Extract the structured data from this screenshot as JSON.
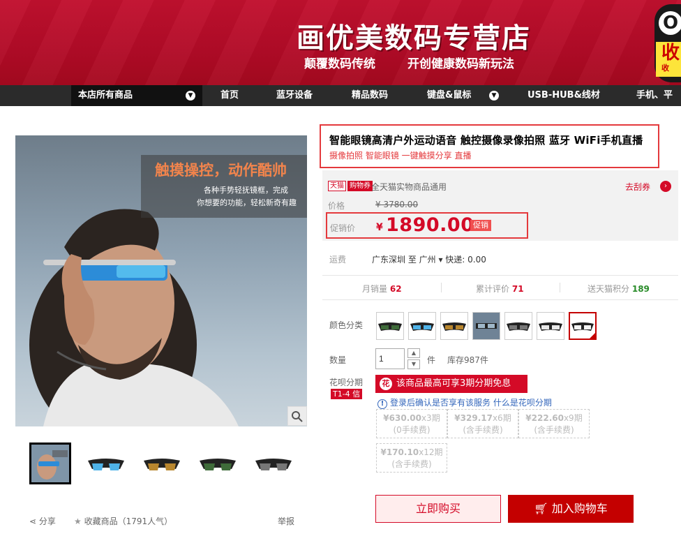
{
  "banner": {
    "shop_title": "画优美数码专营店",
    "slogan1": "颠覆数码传统",
    "slogan2": "开创健康数码新玩法",
    "fav_letter": "O",
    "fav_text": "收",
    "fav_sub": "收"
  },
  "nav": {
    "all_products": "本店所有商品",
    "items": [
      "首页",
      "蓝牙设备",
      "精品数码",
      "键盘&鼠标",
      "USB-HUB&线材",
      "手机、平板"
    ]
  },
  "gallery": {
    "headline": "触摸操控，动作酷帅",
    "line1": "各种手势轻抚镜框，完成",
    "line2": "你想要的功能，轻松新奇有趣"
  },
  "actions": {
    "share": "分享",
    "collect": "收藏商品",
    "collect_count": "（1791人气）",
    "report": "举报"
  },
  "product": {
    "title": "智能眼镜高清户外运动语音 触控摄像录像拍照 蓝牙 WiFi手机直播",
    "subtitle": "摄像拍照 智能眼镜 一键触摸分享 直播"
  },
  "pricing": {
    "tmall_tag": "天猫",
    "coupon_tag": "购物券",
    "coupon_text": "全天猫实物商品通用",
    "coupon_link": "去刮券",
    "price_label": "价格",
    "original_price": "¥ 3780.00",
    "promo_label": "促销价",
    "currency": "¥",
    "promo_price": "1890.00",
    "promo_tag": "促销"
  },
  "shipping": {
    "label": "运费",
    "text": "广东深圳  至 广州 ▾  快递: 0.00"
  },
  "stats": {
    "monthly_label": "月销量",
    "monthly_value": "62",
    "reviews_label": "累计评价",
    "reviews_value": "71",
    "points_label": "送天猫积分",
    "points_value": "189"
  },
  "options": {
    "color_label": "颜色分类",
    "quantity_label": "数量",
    "quantity_value": "1",
    "unit": "件",
    "stock": "库存987件"
  },
  "huabei": {
    "label": "花呗分期",
    "badge": "T1-4 信",
    "banner": "该商品最高可享3期分期免息",
    "note": "登录后确认是否享有该服务  什么是花呗分期",
    "plans": [
      {
        "amount": "¥630.00",
        "period": "x3期",
        "fee": "(0手续费)"
      },
      {
        "amount": "¥329.17",
        "period": "x6期",
        "fee": "(含手续费)"
      },
      {
        "amount": "¥222.60",
        "period": "x9期",
        "fee": "(含手续费)"
      },
      {
        "amount": "¥170.10",
        "period": "x12期",
        "fee": "(含手续费)"
      }
    ]
  },
  "buttons": {
    "buy_now": "立即购买",
    "add_cart": "加入购物车"
  }
}
